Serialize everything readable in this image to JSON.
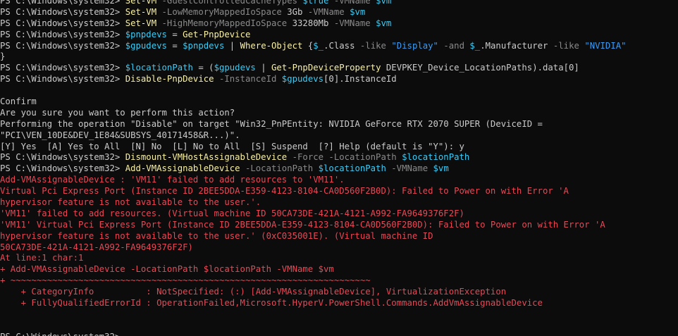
{
  "lines": [
    [
      {
        "t": "PS C:\\Windows\\system32> ",
        "c": "default"
      },
      {
        "t": "Set-VM",
        "c": "cmd"
      },
      {
        "t": " -GuestControlledCacheTypes ",
        "c": "param"
      },
      {
        "t": "$true",
        "c": "var"
      },
      {
        "t": " -VMName ",
        "c": "param"
      },
      {
        "t": "$vm",
        "c": "var"
      }
    ],
    [
      {
        "t": "PS C:\\Windows\\system32> ",
        "c": "default"
      },
      {
        "t": "Set-VM",
        "c": "cmd"
      },
      {
        "t": " -LowMemoryMappedIoSpace ",
        "c": "param"
      },
      {
        "t": "3Gb",
        "c": "num"
      },
      {
        "t": " -VMName ",
        "c": "param"
      },
      {
        "t": "$vm",
        "c": "var"
      }
    ],
    [
      {
        "t": "PS C:\\Windows\\system32> ",
        "c": "default"
      },
      {
        "t": "Set-VM",
        "c": "cmd"
      },
      {
        "t": " -HighMemoryMappedIoSpace ",
        "c": "param"
      },
      {
        "t": "33280Mb",
        "c": "num"
      },
      {
        "t": " -VMName ",
        "c": "param"
      },
      {
        "t": "$vm",
        "c": "var"
      }
    ],
    [
      {
        "t": "PS C:\\Windows\\system32> ",
        "c": "default"
      },
      {
        "t": "$pnpdevs",
        "c": "var"
      },
      {
        "t": " = ",
        "c": "default"
      },
      {
        "t": "Get-PnpDevice",
        "c": "cmd"
      }
    ],
    [
      {
        "t": "PS C:\\Windows\\system32> ",
        "c": "default"
      },
      {
        "t": "$gpudevs",
        "c": "var"
      },
      {
        "t": " = ",
        "c": "default"
      },
      {
        "t": "$pnpdevs",
        "c": "var"
      },
      {
        "t": " | ",
        "c": "default"
      },
      {
        "t": "Where-Object",
        "c": "cmd"
      },
      {
        "t": " {",
        "c": "default"
      },
      {
        "t": "$_",
        "c": "var"
      },
      {
        "t": ".Class ",
        "c": "default"
      },
      {
        "t": "-like",
        "c": "op"
      },
      {
        "t": " ",
        "c": "default"
      },
      {
        "t": "\"Display\"",
        "c": "str"
      },
      {
        "t": " ",
        "c": "default"
      },
      {
        "t": "-and",
        "c": "op"
      },
      {
        "t": " ",
        "c": "default"
      },
      {
        "t": "$_",
        "c": "var"
      },
      {
        "t": ".Manufacturer ",
        "c": "default"
      },
      {
        "t": "-like",
        "c": "op"
      },
      {
        "t": " ",
        "c": "default"
      },
      {
        "t": "\"NVIDIA\"",
        "c": "str"
      }
    ],
    [
      {
        "t": "}",
        "c": "default"
      }
    ],
    [
      {
        "t": "PS C:\\Windows\\system32> ",
        "c": "default"
      },
      {
        "t": "$locationPath",
        "c": "var"
      },
      {
        "t": " = (",
        "c": "default"
      },
      {
        "t": "$gpudevs",
        "c": "var"
      },
      {
        "t": " | ",
        "c": "default"
      },
      {
        "t": "Get-PnpDeviceProperty",
        "c": "cmd"
      },
      {
        "t": " DEVPKEY_Device_LocationPaths).data[0]",
        "c": "default"
      }
    ],
    [
      {
        "t": "PS C:\\Windows\\system32> ",
        "c": "default"
      },
      {
        "t": "Disable-PnpDevice",
        "c": "cmd"
      },
      {
        "t": " -InstanceId ",
        "c": "param"
      },
      {
        "t": "$gpudevs",
        "c": "var"
      },
      {
        "t": "[0].InstanceId",
        "c": "default"
      }
    ],
    [
      {
        "t": "",
        "c": "default"
      }
    ],
    [
      {
        "t": "Confirm",
        "c": "default"
      }
    ],
    [
      {
        "t": "Are you sure you want to perform this action?",
        "c": "default"
      }
    ],
    [
      {
        "t": "Performing the operation \"Disable\" on target \"Win32_PnPEntity: NVIDIA GeForce RTX 2070 SUPER (DeviceID =",
        "c": "default"
      }
    ],
    [
      {
        "t": "\"PCI\\VEN_10DE&DEV_1E84&SUBSYS_40171458&R...)\".",
        "c": "default"
      }
    ],
    [
      {
        "t": "[Y] Yes  [A] Yes to All  [N] No  [L] No to All  [S] Suspend  [?] Help (default is \"Y\"): y",
        "c": "default"
      }
    ],
    [
      {
        "t": "PS C:\\Windows\\system32> ",
        "c": "default"
      },
      {
        "t": "Dismount-VMHostAssignableDevice",
        "c": "cmd"
      },
      {
        "t": " -Force -LocationPath ",
        "c": "param"
      },
      {
        "t": "$locationPath",
        "c": "var"
      }
    ],
    [
      {
        "t": "PS C:\\Windows\\system32> ",
        "c": "default"
      },
      {
        "t": "Add-VMAssignableDevice",
        "c": "cmd"
      },
      {
        "t": " -LocationPath ",
        "c": "param"
      },
      {
        "t": "$locationPath",
        "c": "var"
      },
      {
        "t": " -VMName ",
        "c": "param"
      },
      {
        "t": "$vm",
        "c": "var"
      }
    ],
    [
      {
        "t": "Add-VMAssignableDevice : 'VM11' failed to add resources to 'VM11'.",
        "c": "error"
      }
    ],
    [
      {
        "t": "Virtual Pci Express Port (Instance ID 2BEE5DDA-E359-4123-8104-CA0D560F2B0D): Failed to Power on with Error 'A",
        "c": "error"
      }
    ],
    [
      {
        "t": "hypervisor feature is not available to the user.'.",
        "c": "error"
      }
    ],
    [
      {
        "t": "'VM11' failed to add resources. (Virtual machine ID 50CA73DE-421A-4121-A992-FA9649376F2F)",
        "c": "error"
      }
    ],
    [
      {
        "t": "'VM11' Virtual Pci Express Port (Instance ID 2BEE5DDA-E359-4123-8104-CA0D560F2B0D): Failed to Power on with Error 'A",
        "c": "error"
      }
    ],
    [
      {
        "t": "hypervisor feature is not available to the user.' (0xC035001E). (Virtual machine ID",
        "c": "error"
      }
    ],
    [
      {
        "t": "50CA73DE-421A-4121-A992-FA9649376F2F)",
        "c": "error"
      }
    ],
    [
      {
        "t": "At line:1 char:1",
        "c": "error"
      }
    ],
    [
      {
        "t": "+ Add-VMAssignableDevice -LocationPath $locationPath -VMName $vm",
        "c": "error"
      }
    ],
    [
      {
        "t": "+ ~~~~~~~~~~~~~~~~~~~~~~~~~~~~~~~~~~~~~~~~~~~~~~~~~~~~~~~~~~~~~~~~~~~~~",
        "c": "error"
      }
    ],
    [
      {
        "t": "    + CategoryInfo          : NotSpecified: (:) [Add-VMAssignableDevice], VirtualizationException",
        "c": "error"
      }
    ],
    [
      {
        "t": "    + FullyQualifiedErrorId : OperationFailed,Microsoft.HyperV.PowerShell.Commands.AddVmAssignableDevice",
        "c": "error"
      }
    ],
    [
      {
        "t": "",
        "c": "default"
      }
    ],
    [
      {
        "t": "",
        "c": "default"
      }
    ],
    [
      {
        "t": "PS C:\\Windows\\system32> ",
        "c": "default"
      }
    ]
  ],
  "colors": {
    "background": "#0c0c0c",
    "default": "#cccccc",
    "cmd": "#f9f1a5",
    "param": "#8a8a8a",
    "var": "#3ccbf5",
    "str": "#3b9cf5",
    "error": "#e74856"
  }
}
